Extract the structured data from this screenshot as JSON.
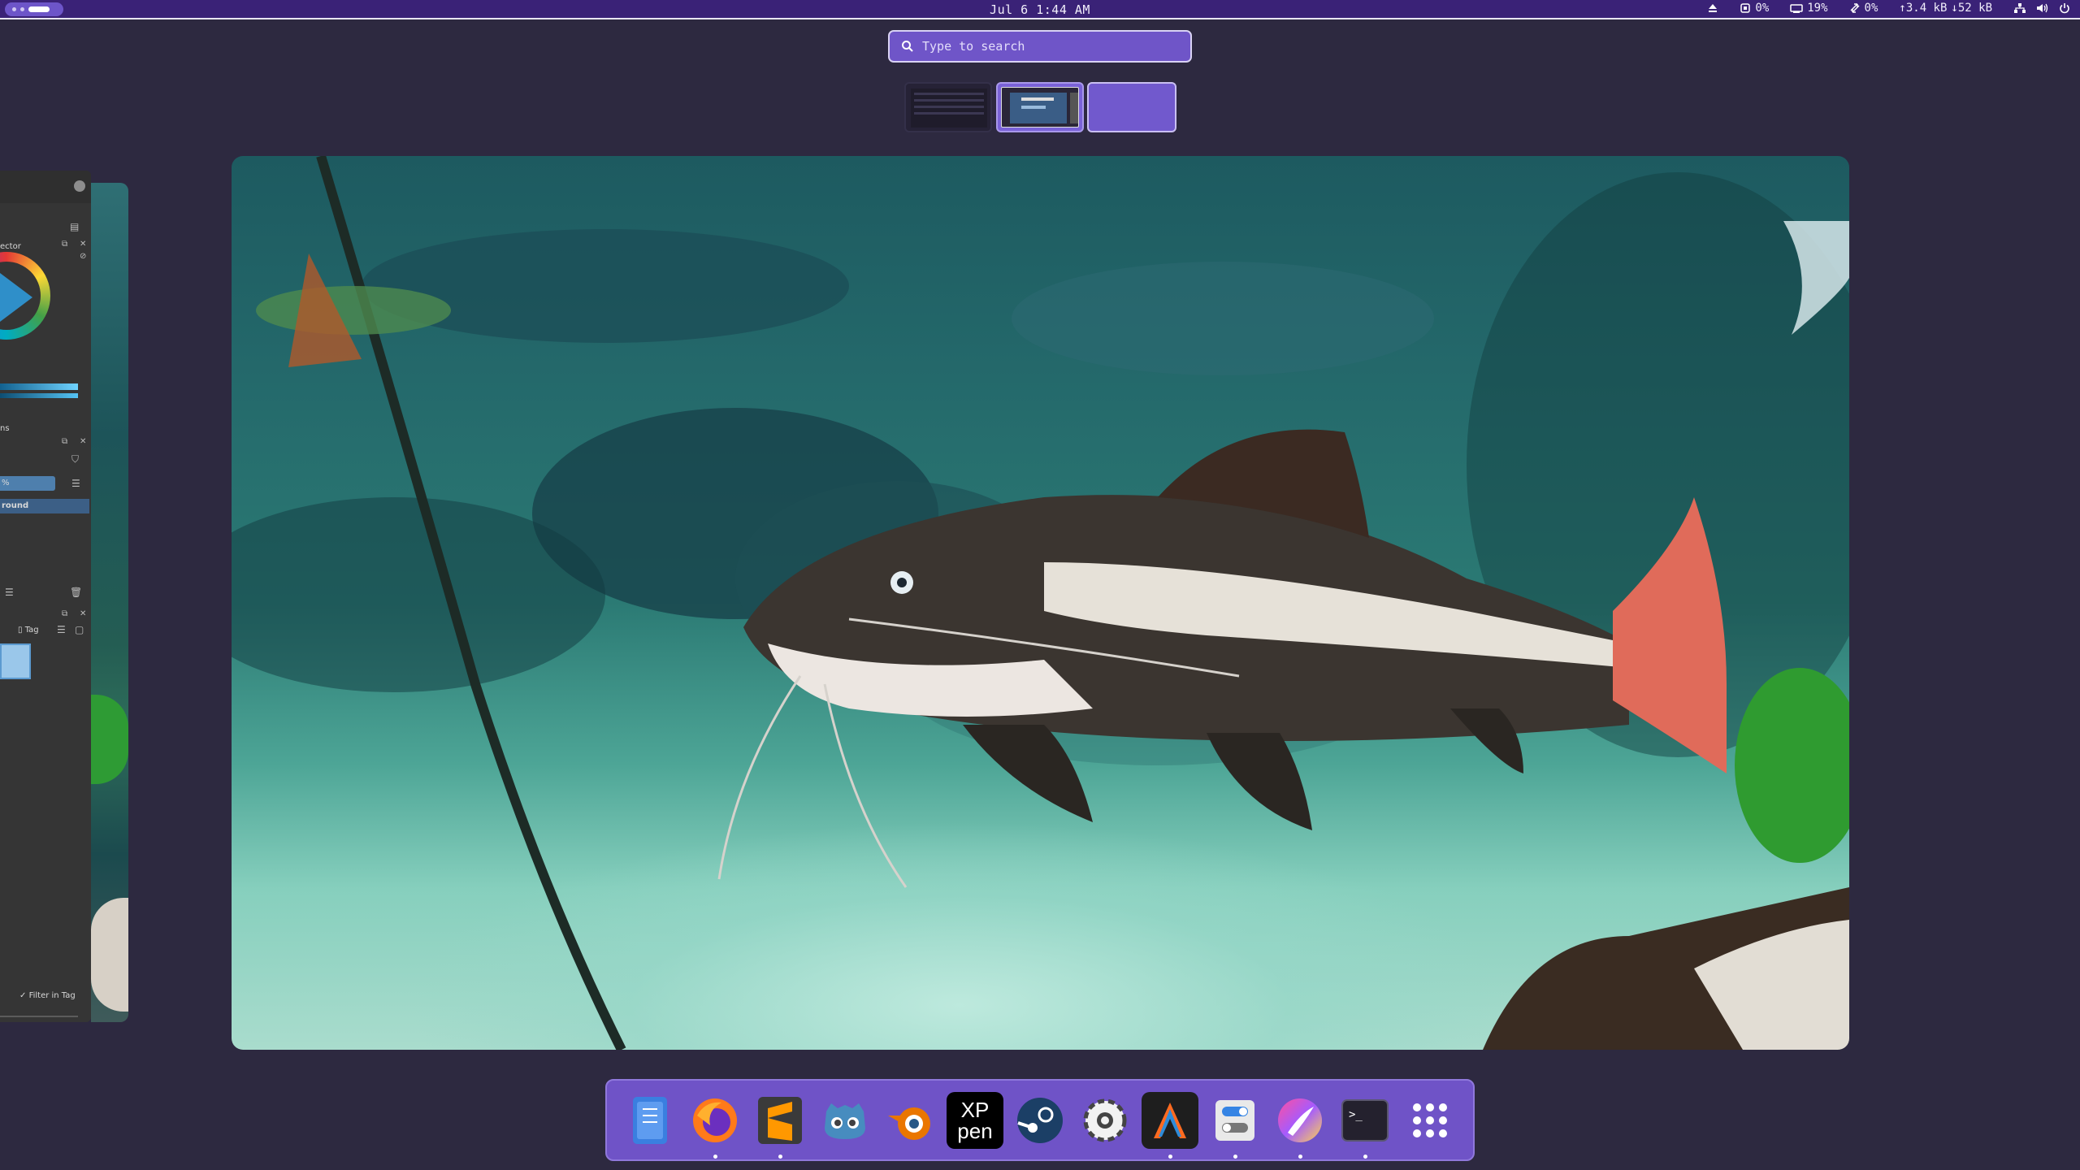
{
  "topbar": {
    "clock": "Jul 6  1:44 AM",
    "cpu": "0%",
    "memory": "19%",
    "swap": "0%",
    "upload": "↑3.4 kB",
    "download": "↓52 kB"
  },
  "search": {
    "placeholder": "Type to search"
  },
  "left_window": {
    "panel_selector": "ector",
    "panel_layers": "ns",
    "opacity_field": "%",
    "layer_name": "round",
    "tag_label": "Tag",
    "filter_in_tag": "Filter in Tag"
  },
  "dock": {
    "apps": [
      {
        "name": "Files",
        "icon": "files-icon",
        "running": false
      },
      {
        "name": "Firefox",
        "icon": "firefox-icon",
        "running": true
      },
      {
        "name": "Sublime Text",
        "icon": "sublime-icon",
        "running": true
      },
      {
        "name": "Godot",
        "icon": "godot-icon",
        "running": false
      },
      {
        "name": "Blender",
        "icon": "blender-icon",
        "running": false
      },
      {
        "name": "XP-Pen",
        "icon": "xppen-icon",
        "label": "XP pen",
        "running": false
      },
      {
        "name": "Steam",
        "icon": "steam-icon",
        "running": false
      },
      {
        "name": "Settings",
        "icon": "settings-icon",
        "running": false
      },
      {
        "name": "Alacritty",
        "icon": "alacritty-icon",
        "running": true
      },
      {
        "name": "Tweaks",
        "icon": "tweaks-icon",
        "running": true
      },
      {
        "name": "Krita",
        "icon": "krita-icon",
        "running": true
      },
      {
        "name": "Terminal",
        "icon": "terminal-icon",
        "label": ">_",
        "running": true
      },
      {
        "name": "Show Apps",
        "icon": "app-grid-icon",
        "running": false
      }
    ]
  }
}
